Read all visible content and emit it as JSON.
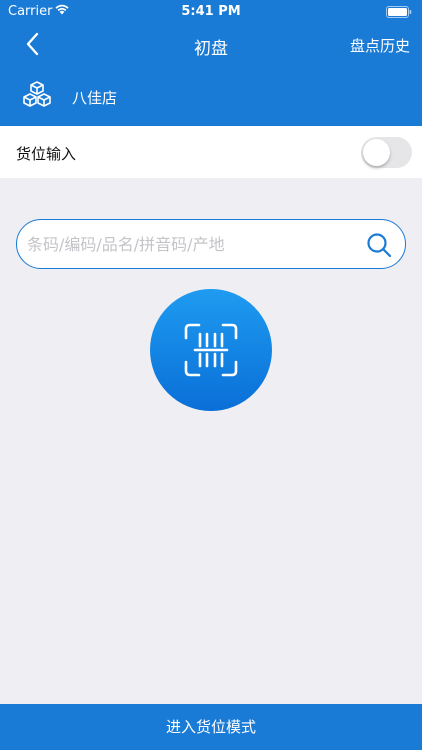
{
  "status_bar": {
    "carrier": "Carrier",
    "time": "5:41 PM"
  },
  "nav": {
    "title": "初盘",
    "history_label": "盘点历史"
  },
  "store": {
    "name": "八佳店"
  },
  "location_input": {
    "label": "货位输入",
    "enabled": false
  },
  "search": {
    "placeholder": "条码/编码/品名/拼音码/产地",
    "value": ""
  },
  "footer": {
    "button_label": "进入货位模式"
  },
  "colors": {
    "primary": "#1a7bd6",
    "background": "#efeef2"
  },
  "icons": [
    "back-chevron-icon",
    "cubes-icon",
    "search-icon",
    "barcode-scan-icon",
    "wifi-icon",
    "battery-icon"
  ]
}
